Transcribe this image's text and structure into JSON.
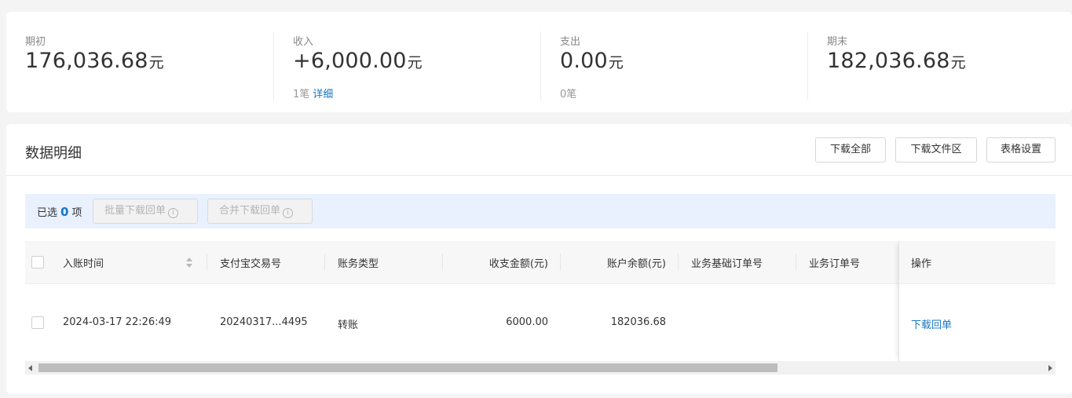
{
  "summary": {
    "opening": {
      "label": "期初",
      "value": "176,036.68",
      "unit": "元"
    },
    "income": {
      "label": "收入",
      "value": "+6,000.00",
      "unit": "元",
      "count": "1笔",
      "detail_link": "详细"
    },
    "expense": {
      "label": "支出",
      "value": "0.00",
      "unit": "元",
      "count": "0笔"
    },
    "closing": {
      "label": "期末",
      "value": "182,036.68",
      "unit": "元"
    }
  },
  "detail": {
    "title": "数据明细",
    "buttons": {
      "download_all": "下载全部",
      "download_files": "下载文件区",
      "table_settings": "表格设置"
    }
  },
  "selection": {
    "prefix": "已选",
    "count": "0",
    "suffix": "项",
    "batch_download": "批量下载回单",
    "merge_download": "合并下载回单"
  },
  "table": {
    "columns": [
      "入账时间",
      "支付宝交易号",
      "账务类型",
      "收支金额(元)",
      "账户余额(元)",
      "业务基础订单号",
      "业务订单号",
      "操作"
    ],
    "rows": [
      {
        "time": "2024-03-17 22:26:49",
        "trade_no": "20240317...4495",
        "type": "转账",
        "amount": "6000.00",
        "balance": "182036.68",
        "base_order_no": "",
        "order_no": "",
        "action": "下载回单"
      }
    ]
  },
  "scrollbar": {
    "position_fraction": 0.0,
    "visible_fraction": 0.74
  },
  "colors": {
    "link": "#1677c5",
    "selection_bar": "#e8f1fd",
    "background": "#f4f4f4"
  }
}
